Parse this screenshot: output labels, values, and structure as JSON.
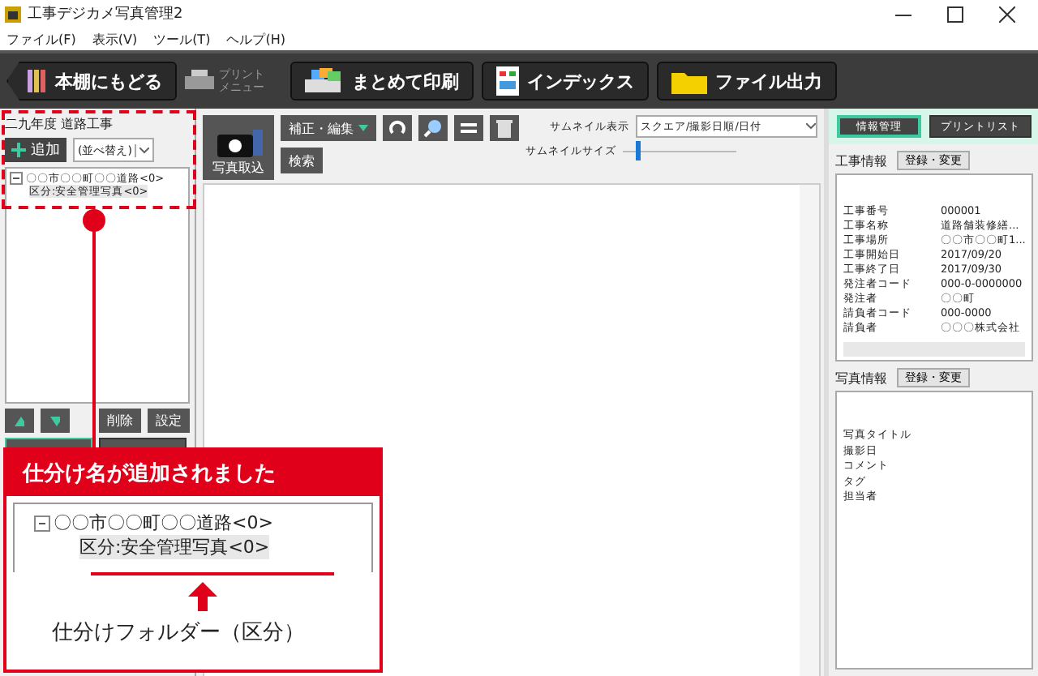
{
  "window": {
    "title": "工事デジカメ写真管理2"
  },
  "menu": [
    "ファイル(F)",
    "表示(V)",
    "ツール(T)",
    "ヘルプ(H)"
  ],
  "toolbar": {
    "back": "本棚にもどる",
    "print_menu": {
      "lines": [
        "プリント",
        "メニュー"
      ],
      "disabled": true
    },
    "buttons": [
      {
        "kind": "print",
        "label": "まとめて印刷"
      },
      {
        "kind": "index",
        "label": "インデックス"
      },
      {
        "kind": "folder",
        "label": "ファイル出力"
      }
    ]
  },
  "left_panel": {
    "project_title": "二九年度 道路工事",
    "add_button": "追加",
    "sort_select": "(並べ替え)",
    "tree": [
      {
        "label": "〇〇市〇〇町〇〇道路<0>",
        "expanded": true,
        "children": [
          {
            "label": "区分:安全管理写真<0>",
            "selected": true
          }
        ]
      }
    ],
    "buttons": [
      "削除",
      "設定"
    ]
  },
  "center": {
    "import_button": "写真取込",
    "edit_button": "補正・編集",
    "search_button": "検索",
    "thumbnail_view_label": "サムネイル表示",
    "thumbnail_view_value": "スクエア/撮影日順/日付",
    "thumbnail_size_label": "サムネイルサイズ",
    "thumbnail_size": {
      "level": 0.12
    }
  },
  "right_panel": {
    "tabs": [
      {
        "label": "情報管理",
        "selected": true
      },
      {
        "label": "プリントリスト",
        "selected": false
      }
    ],
    "project_info": {
      "heading": "工事情報",
      "edit_button": "登録・変更",
      "rows": [
        {
          "label": "工事番号",
          "value": "000001"
        },
        {
          "label": "工事名称",
          "value": "道路舗装修繕..."
        },
        {
          "label": "工事場所",
          "value": "〇〇市〇〇町1..."
        },
        {
          "label": "工事開始日",
          "value": "2017/09/20"
        },
        {
          "label": "工事終了日",
          "value": "2017/09/30"
        },
        {
          "label": "発注者コード",
          "value": "000-0-0000000"
        },
        {
          "label": "発注者",
          "value": "〇〇町"
        },
        {
          "label": "請負者コード",
          "value": "000-0000"
        },
        {
          "label": "請負者",
          "value": "〇〇〇株式会社"
        }
      ]
    },
    "photo_info": {
      "heading": "写真情報",
      "edit_button": "登録・変更",
      "rows": [
        "写真タイトル",
        "撮影日",
        "コメント",
        "タグ",
        "担当者"
      ]
    }
  },
  "callout": {
    "title": "仕分け名が追加されました",
    "tree": [
      {
        "label": "〇〇市〇〇町〇〇道路<0>",
        "expanded": true,
        "children": [
          {
            "label": "区分:安全管理写真<0>",
            "selected": true
          }
        ]
      }
    ],
    "caption": "仕分けフォルダー（区分）"
  }
}
